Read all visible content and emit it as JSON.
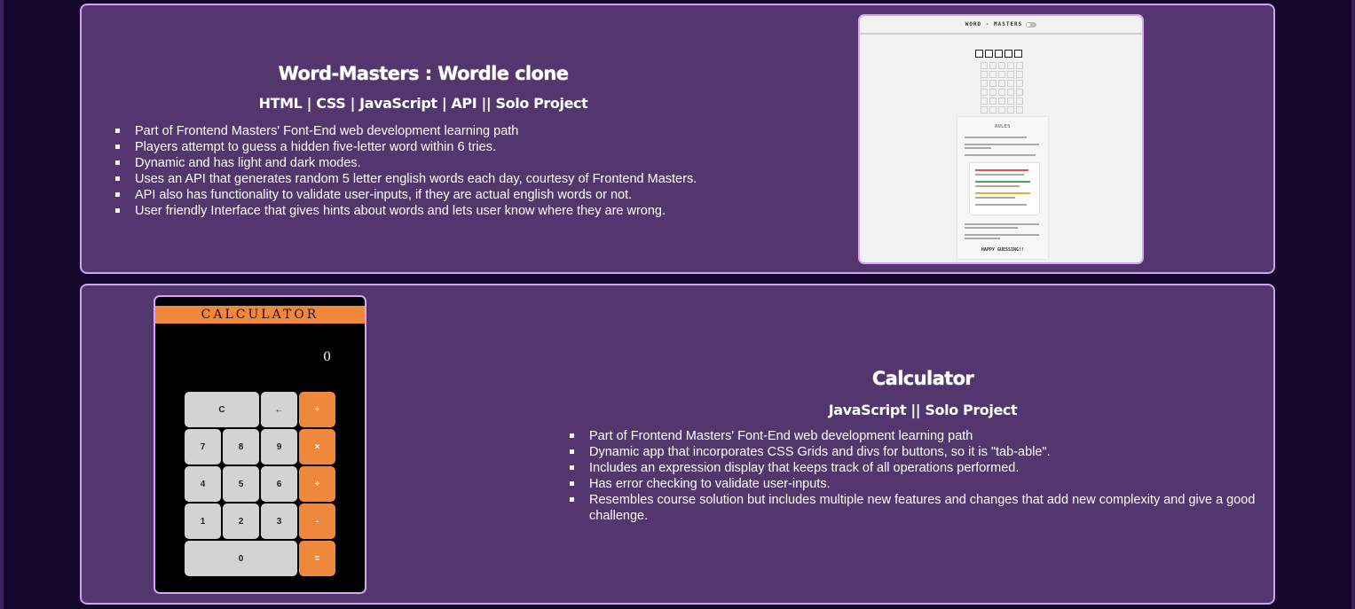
{
  "projects": [
    {
      "title": "Word-Masters : Wordle clone",
      "tech": "HTML | CSS | JavaScript | API || Solo Project",
      "bullets": [
        "Part of Frontend Masters' Font-End web development learning path",
        "Players attempt to guess a hidden five-letter word within 6 tries.",
        "Dynamic and has light and dark modes.",
        "Uses an API that generates random 5 letter english words each day, courtesy of Frontend Masters.",
        "API also has functionality to validate user-inputs, if they are actual english words or not.",
        "User friendly Interface that gives hints about words and lets user know where they are wrong."
      ],
      "preview": {
        "header": "WORD - MASTERS",
        "rules_title": "RULES",
        "footer": "HAPPY GUESSING!!"
      }
    },
    {
      "title": "Calculator",
      "tech": "JavaScript || Solo Project",
      "bullets": [
        "Part of Frontend Masters' Font-End web development learning path",
        "Dynamic app that incorporates CSS Grids and divs for buttons, so it is \"tab-able\".",
        "Includes an expression display that keeps track of all operations performed.",
        "Has error checking to validate user-inputs.",
        "Resembles course solution but includes multiple new features and changes that add new complexity and give a good challenge."
      ],
      "preview": {
        "header": "CALCULATOR",
        "display": "0",
        "keys": [
          "C",
          "←",
          "÷",
          "7",
          "8",
          "9",
          "×",
          "4",
          "5",
          "6",
          "+",
          "1",
          "2",
          "3",
          "-",
          "0",
          "="
        ]
      }
    }
  ],
  "colors": {
    "page_bg": "#17062b",
    "card_bg": "#52366d",
    "card_border": "#c9a4f0",
    "calc_accent": "#ef873c"
  }
}
